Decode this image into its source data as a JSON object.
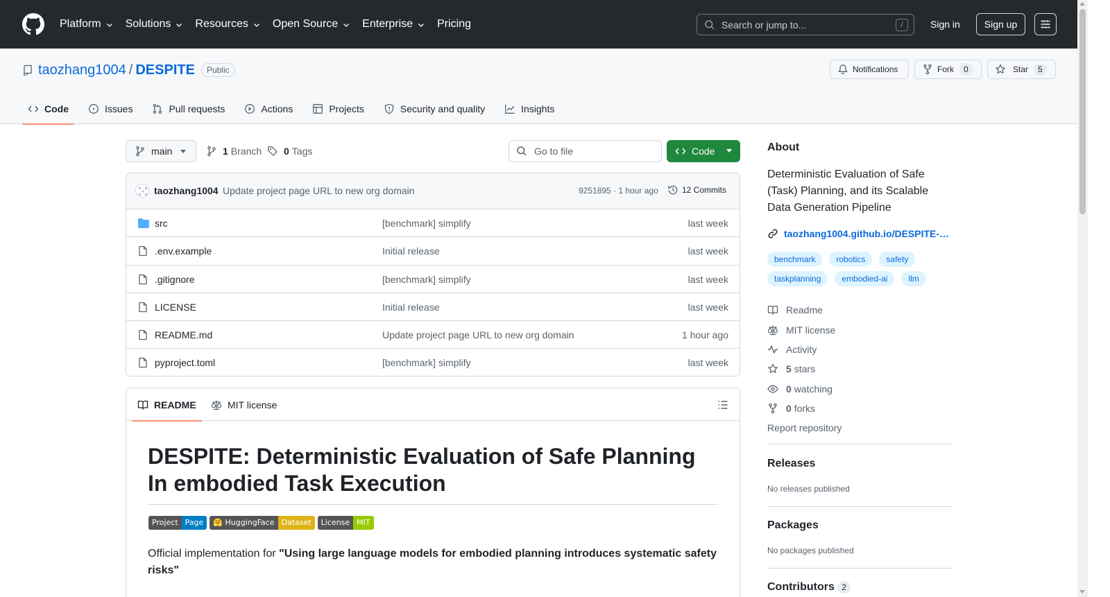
{
  "colors": {
    "header_bg": "#25292e",
    "link": "#0969da",
    "primary_green": "#1f883d",
    "active_tab_underline": "#fd8c73",
    "topic_bg": "#ddf4ff"
  },
  "header": {
    "nav": [
      "Platform",
      "Solutions",
      "Resources",
      "Open Source",
      "Enterprise",
      "Pricing"
    ],
    "search_placeholder": "Search or jump to...",
    "search_shortcut": "/",
    "sign_in": "Sign in",
    "sign_up": "Sign up"
  },
  "repo": {
    "owner": "taozhang1004",
    "separator": "/",
    "name": "DESPITE",
    "visibility": "Public",
    "notifications_label": "Notifications",
    "fork_label": "Fork",
    "fork_count": "0",
    "star_label": "Star",
    "star_count": "5"
  },
  "tabs": [
    {
      "label": "Code",
      "icon": "code-icon",
      "active": true
    },
    {
      "label": "Issues",
      "icon": "issue-icon"
    },
    {
      "label": "Pull requests",
      "icon": "pull-request-icon"
    },
    {
      "label": "Actions",
      "icon": "play-icon"
    },
    {
      "label": "Projects",
      "icon": "table-icon"
    },
    {
      "label": "Security and quality",
      "icon": "shield-icon"
    },
    {
      "label": "Insights",
      "icon": "graph-icon"
    }
  ],
  "toolbar": {
    "branch": "main",
    "branch_count": "1",
    "branch_label": "Branch",
    "tag_count": "0",
    "tag_label": "Tags",
    "go_to_file": "Go to file",
    "code_button": "Code"
  },
  "commit": {
    "author": "taozhang1004",
    "message": "Update project page URL to new org domain",
    "hash_time": "9251895 · 1 hour ago",
    "commits_label": "12 Commits"
  },
  "files": [
    {
      "name": "src",
      "type": "folder",
      "message": "[benchmark] simplify",
      "time": "last week"
    },
    {
      "name": ".env.example",
      "type": "file",
      "message": "Initial release",
      "time": "last week"
    },
    {
      "name": ".gitignore",
      "type": "file",
      "message": "[benchmark] simplify",
      "time": "last week"
    },
    {
      "name": "LICENSE",
      "type": "file",
      "message": "Initial release",
      "time": "last week"
    },
    {
      "name": "README.md",
      "type": "file",
      "message": "Update project page URL to new org domain",
      "time": "1 hour ago"
    },
    {
      "name": "pyproject.toml",
      "type": "file",
      "message": "[benchmark] simplify",
      "time": "last week"
    }
  ],
  "readme": {
    "tab_readme": "README",
    "tab_license": "MIT license",
    "title": "DESPITE: Deterministic Evaluation of Safe Planning In embodied Task Execution",
    "shields": [
      {
        "left": "Project",
        "right": "Page",
        "color": "#007ec6"
      },
      {
        "left": "🤗 HuggingFace",
        "right": "Dataset",
        "color": "#dfb317"
      },
      {
        "left": "License",
        "right": "MIT",
        "color": "#97ca00"
      }
    ],
    "intro_prefix": "Official implementation for ",
    "intro_bold": "\"Using large language models for embodied planning introduces systematic safety risks\""
  },
  "about": {
    "heading": "About",
    "description": "Deterministic Evaluation of Safe (Task) Planning, and its Scalable Data Generation Pipeline",
    "link": "taozhang1004.github.io/DESPITE-s...",
    "topics": [
      "benchmark",
      "robotics",
      "safety",
      "taskplanning",
      "embodied-ai",
      "llm"
    ],
    "readme": "Readme",
    "license": "MIT license",
    "activity": "Activity",
    "stars_count": "5",
    "stars_label": "stars",
    "watching_count": "0",
    "watching_label": "watching",
    "forks_count": "0",
    "forks_label": "forks",
    "report": "Report repository"
  },
  "releases": {
    "heading": "Releases",
    "empty": "No releases published"
  },
  "packages": {
    "heading": "Packages",
    "empty": "No packages published"
  },
  "contributors": {
    "heading": "Contributors",
    "count": "2"
  }
}
